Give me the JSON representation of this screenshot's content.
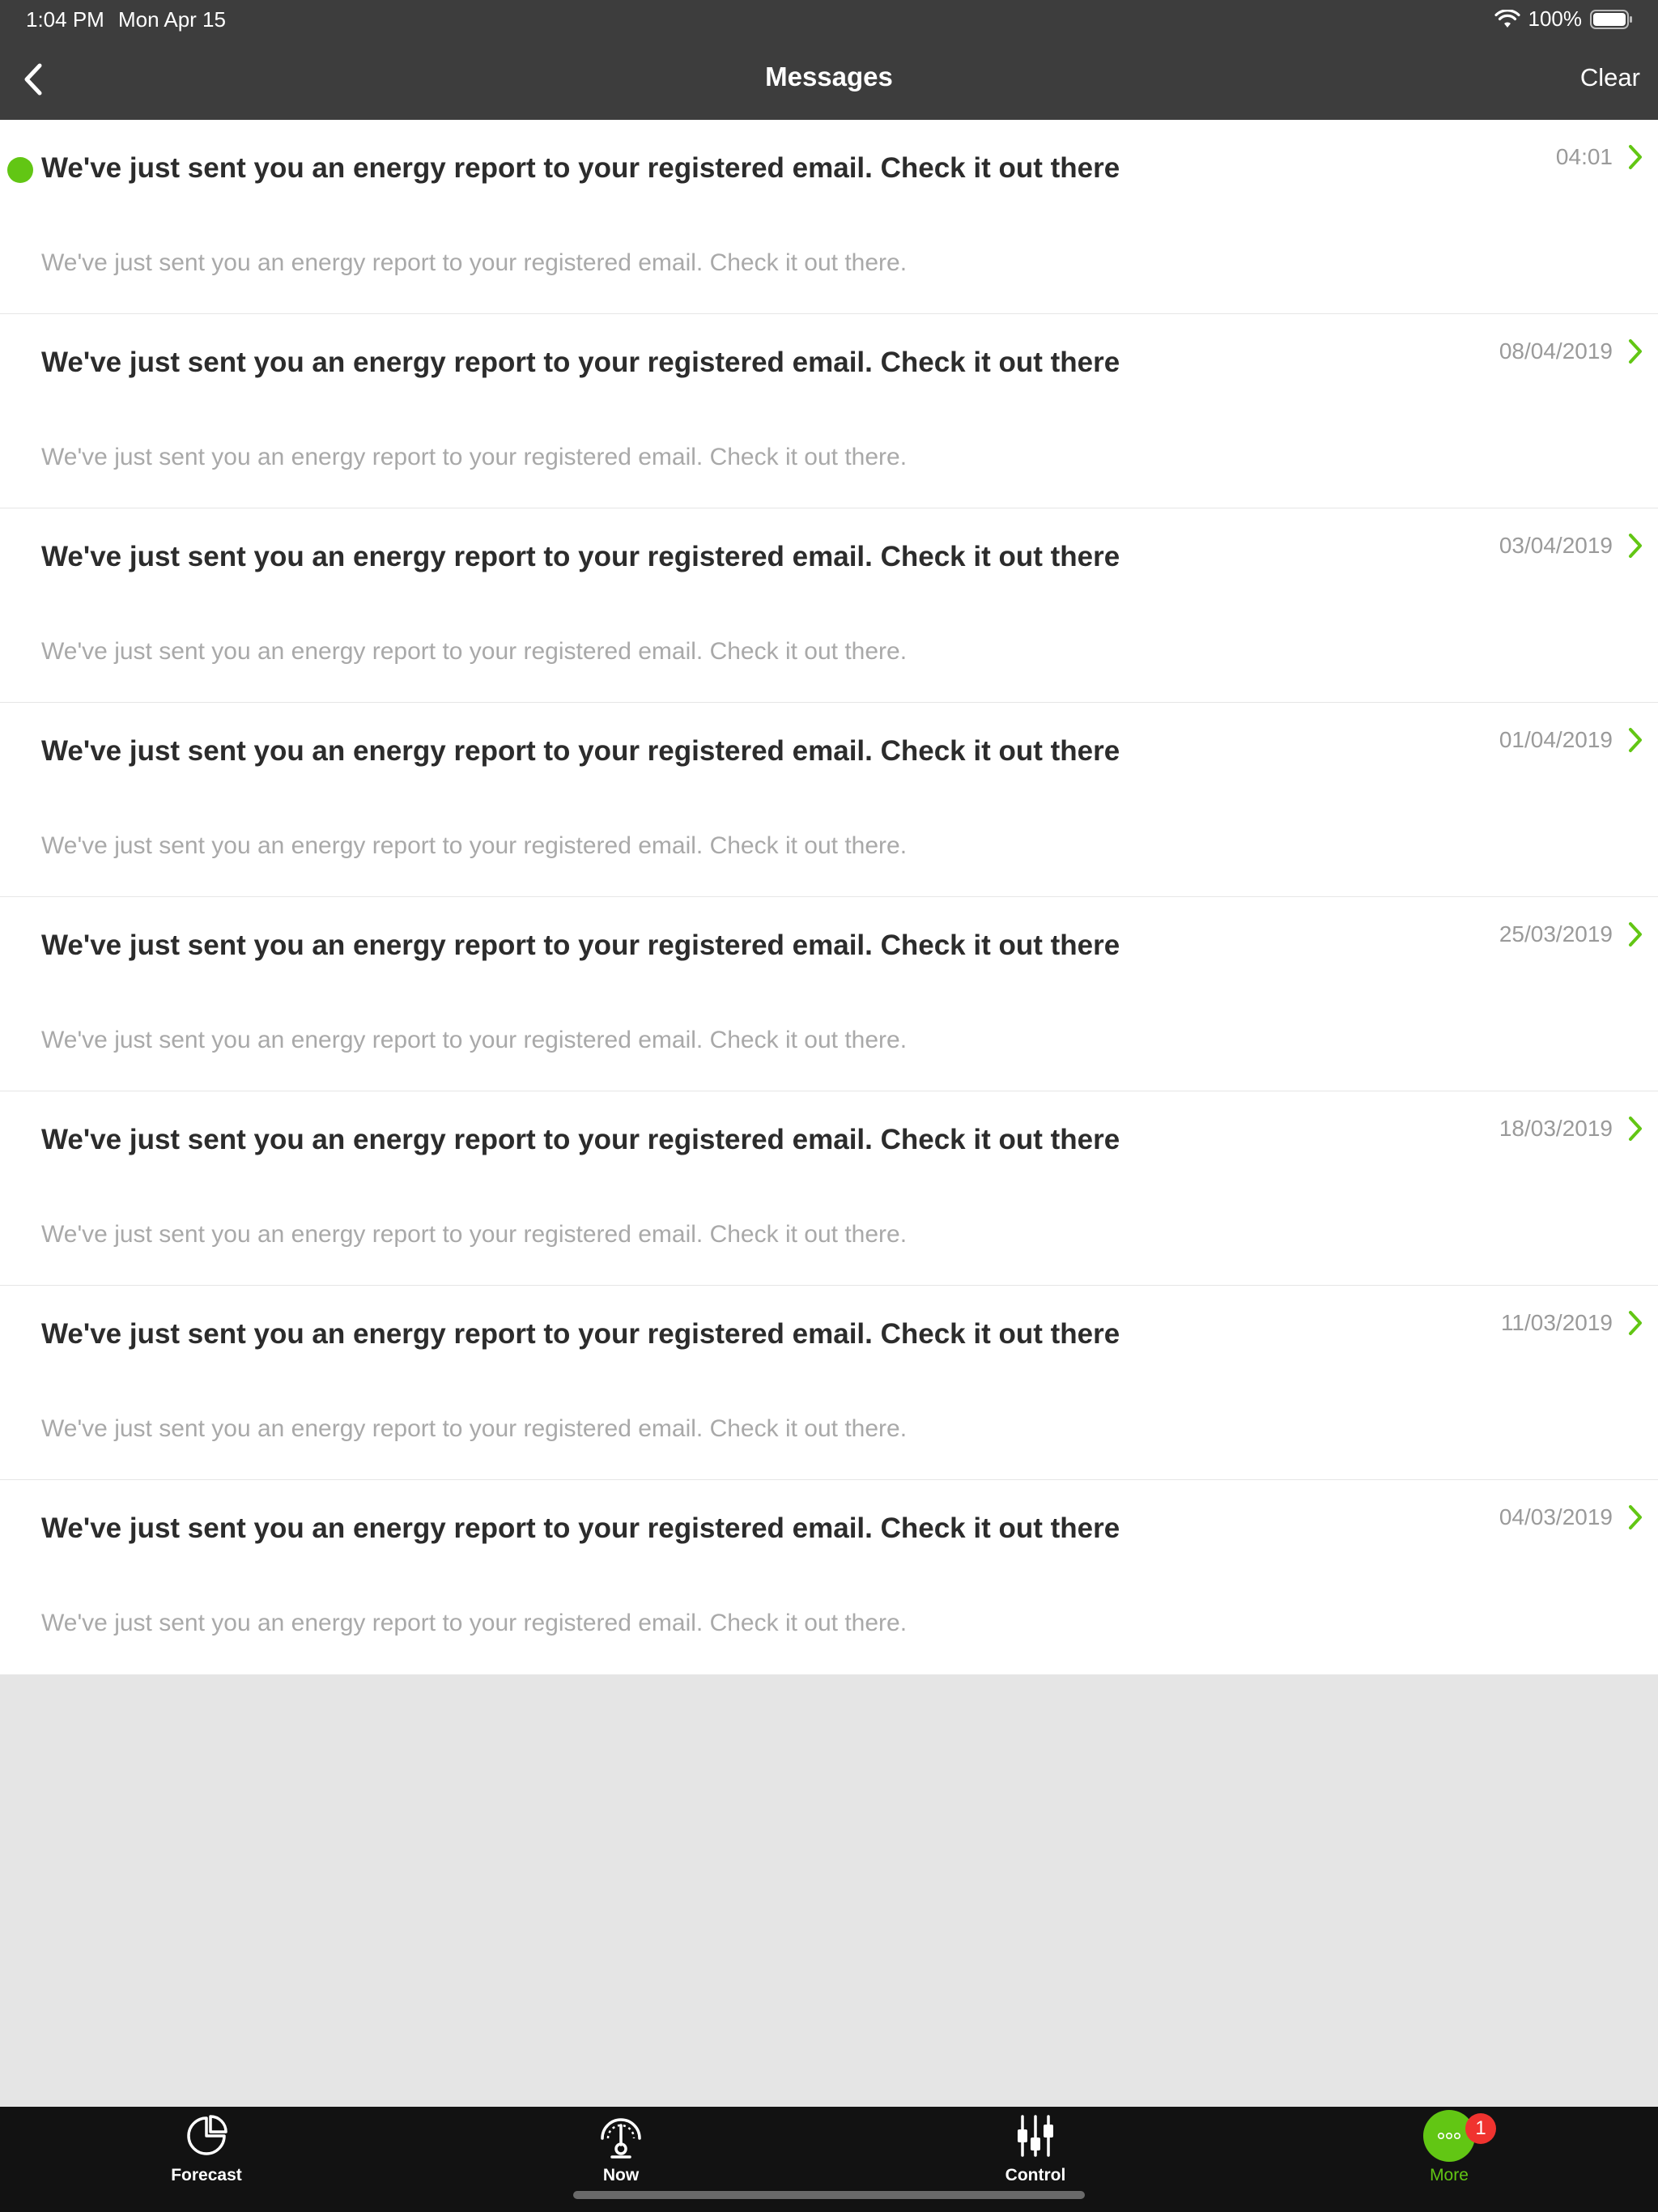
{
  "status_bar": {
    "time": "1:04 PM",
    "date": "Mon Apr 15",
    "battery": "100%"
  },
  "nav": {
    "title": "Messages",
    "clear_label": "Clear",
    "back_icon": "chevron-left-icon"
  },
  "messages": [
    {
      "title": "We've just sent you an energy report to your registered email. Check it out there",
      "body": "We've just sent you an energy report to your registered email. Check it out there.",
      "date": "04:01",
      "unread": true
    },
    {
      "title": "We've just sent you an energy report to your registered email. Check it out there",
      "body": "We've just sent you an energy report to your registered email. Check it out there.",
      "date": "08/04/2019",
      "unread": false
    },
    {
      "title": "We've just sent you an energy report to your registered email. Check it out there",
      "body": "We've just sent you an energy report to your registered email. Check it out there.",
      "date": "03/04/2019",
      "unread": false
    },
    {
      "title": "We've just sent you an energy report to your registered email. Check it out there",
      "body": "We've just sent you an energy report to your registered email. Check it out there.",
      "date": "01/04/2019",
      "unread": false
    },
    {
      "title": "We've just sent you an energy report to your registered email. Check it out there",
      "body": "We've just sent you an energy report to your registered email. Check it out there.",
      "date": "25/03/2019",
      "unread": false
    },
    {
      "title": "We've just sent you an energy report to your registered email. Check it out there",
      "body": "We've just sent you an energy report to your registered email. Check it out there.",
      "date": "18/03/2019",
      "unread": false
    },
    {
      "title": "We've just sent you an energy report to your registered email. Check it out there",
      "body": "We've just sent you an energy report to your registered email. Check it out there.",
      "date": "11/03/2019",
      "unread": false
    },
    {
      "title": "We've just sent you an energy report to your registered email. Check it out there",
      "body": "We've just sent you an energy report to your registered email. Check it out there.",
      "date": "04/03/2019",
      "unread": false
    }
  ],
  "tabs": [
    {
      "label": "Forecast",
      "icon": "forecast-icon"
    },
    {
      "label": "Now",
      "icon": "gauge-icon"
    },
    {
      "label": "Control",
      "icon": "sliders-icon"
    },
    {
      "label": "More",
      "icon": "more-icon",
      "badge": "1",
      "active": true
    }
  ],
  "colors": {
    "accent": "#62c614",
    "header_bg": "#3d3d3d",
    "tabbar_bg": "#121212",
    "badge": "#f0332f",
    "empty_bg": "#e5e5e5"
  }
}
